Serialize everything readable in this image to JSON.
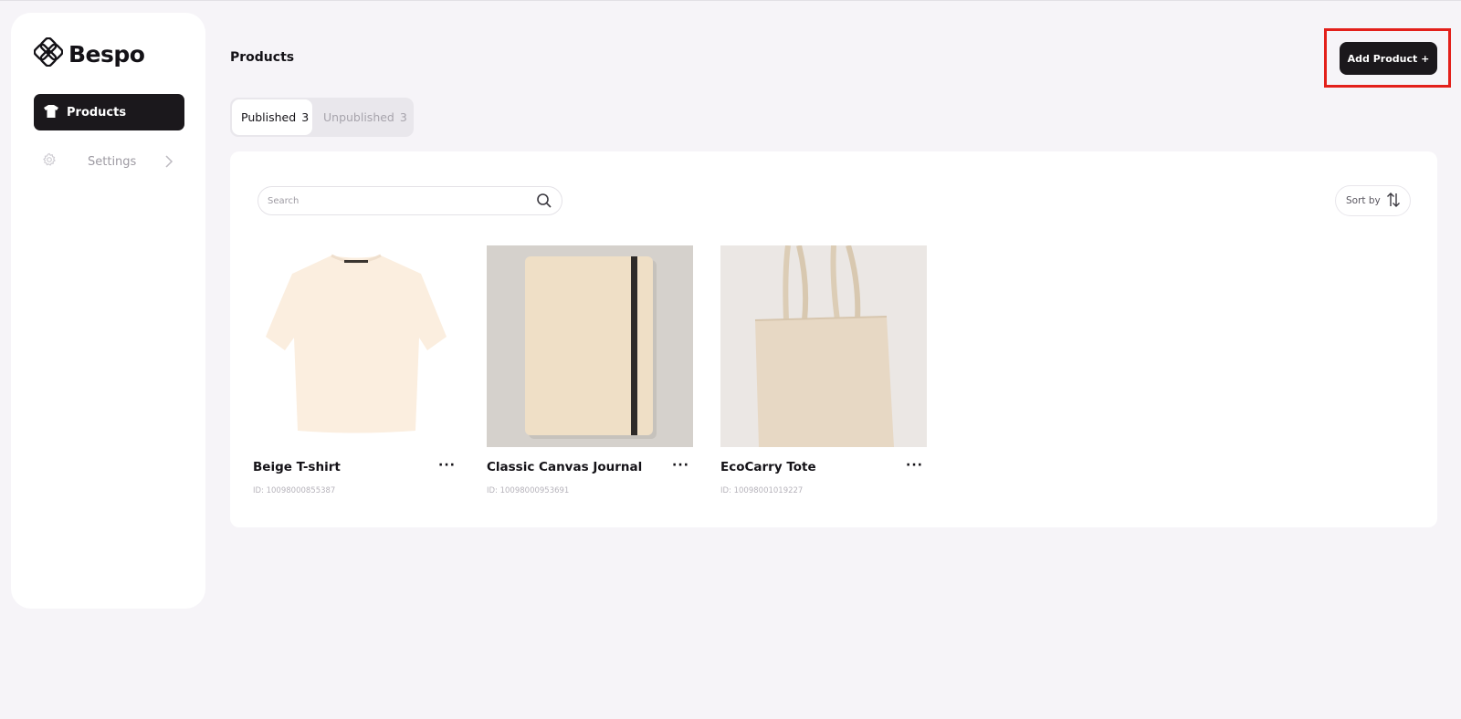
{
  "app": {
    "brand": "Bespo"
  },
  "sidebar": {
    "items": [
      {
        "label": "Products",
        "icon": "tshirt-icon",
        "active": true
      },
      {
        "label": "Settings",
        "icon": "gear-icon",
        "active": false
      }
    ]
  },
  "header": {
    "title": "Products",
    "add_button_label": "Add Product +"
  },
  "tabs": [
    {
      "label": "Published",
      "count": "3",
      "selected": true
    },
    {
      "label": "Unpublished",
      "count": "3",
      "selected": false
    }
  ],
  "toolbar": {
    "search_placeholder": "Search",
    "sort_label": "Sort by"
  },
  "products": [
    {
      "name": "Beige T-shirt",
      "id": "ID: 10098000855387",
      "image": "tshirt-image"
    },
    {
      "name": "Classic Canvas Journal",
      "id": "ID: 10098000953691",
      "image": "journal-image"
    },
    {
      "name": "EcoCarry Tote",
      "id": "ID: 10098001019227",
      "image": "tote-image"
    }
  ],
  "colors": {
    "background": "#f6f4f8",
    "dark_button": "#1b181c",
    "highlight_box": "#e3201b"
  }
}
